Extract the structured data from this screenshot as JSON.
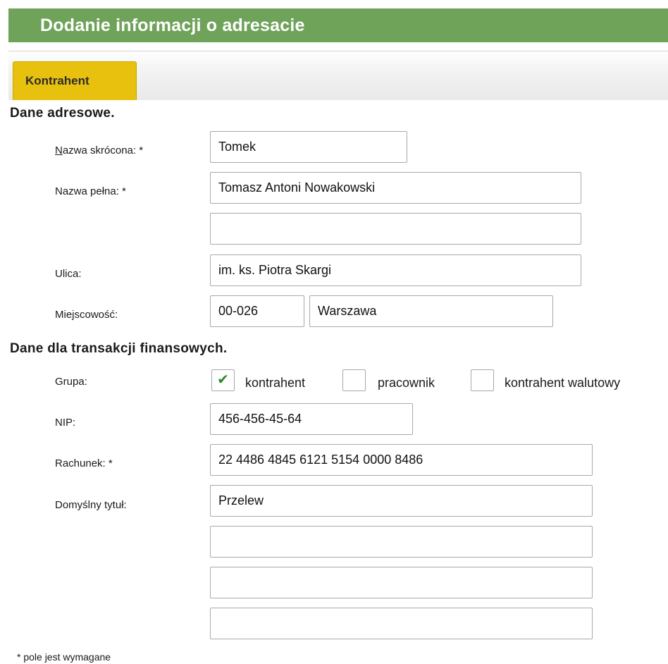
{
  "window": {
    "title": "Dodanie informacji o adresacie"
  },
  "tabs": [
    {
      "label": "Kontrahent",
      "active": true
    }
  ],
  "address_section": {
    "title": "Dane adresowe.",
    "short_name": {
      "label_accel": "N",
      "label_rest": "azwa skrócona: *",
      "value": "Tomek"
    },
    "full_name": {
      "label": "Nazwa pełna: *",
      "line1": "Tomasz Antoni Nowakowski",
      "line2": ""
    },
    "street": {
      "label": "Ulica:",
      "value": "im. ks. Piotra Skargi"
    },
    "city": {
      "label": "Miejscowość:",
      "postal_code": "00-026",
      "city_name": "Warszawa"
    }
  },
  "finance_section": {
    "title": "Dane dla transakcji finansowych.",
    "group": {
      "label": "Grupa:",
      "options": [
        {
          "label": "kontrahent",
          "checked": true
        },
        {
          "label": "pracownik",
          "checked": false
        },
        {
          "label": "kontrahent walutowy",
          "checked": false
        }
      ]
    },
    "nip": {
      "label": "NIP:",
      "value": "456-456-45-64"
    },
    "account": {
      "label": "Rachunek: *",
      "value": "22 4486 4845 6121 5154 0000 8486"
    },
    "default_title": {
      "label": "Domyślny tytuł:",
      "lines": [
        "Przelew",
        "",
        "",
        ""
      ]
    }
  },
  "footnote": "* pole jest wymagane",
  "colors": {
    "title_bar": "#6fa35a",
    "active_tab": "#e8c10f",
    "checkmark": "#2d8a24"
  },
  "icons": {
    "checked": "checkmark-icon"
  }
}
